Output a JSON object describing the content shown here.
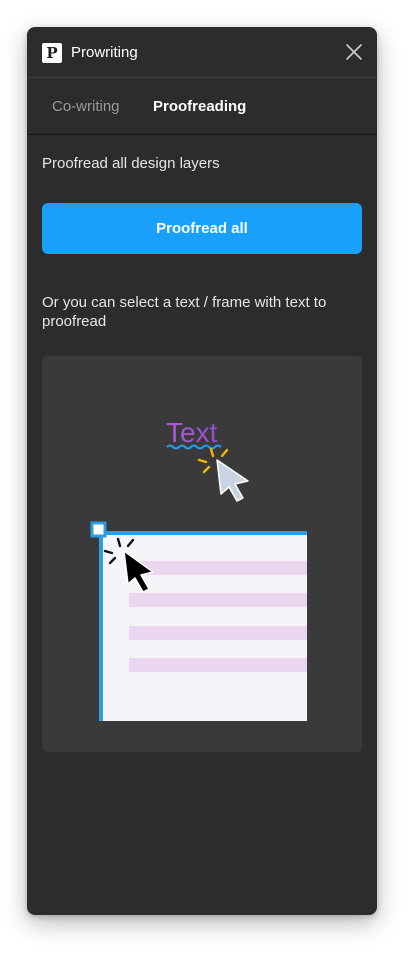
{
  "app": {
    "title": "Prowriting",
    "logo_letter": "P"
  },
  "tabs": [
    {
      "label": "Co-writing",
      "active": false
    },
    {
      "label": "Proofreading",
      "active": true
    }
  ],
  "proofread": {
    "intro": "Proofread all design layers",
    "button_label": "Proofread all",
    "hint": "Or you can select a text / frame with text to proofread"
  },
  "illustration": {
    "sample_text": "Text"
  },
  "colors": {
    "panel_bg": "#2c2c2c",
    "accent": "#18a0fb",
    "illustration_bg": "#3a3a3a",
    "text_gradient_start": "#b05bd6",
    "text_gradient_end": "#8f4fcf",
    "squiggle": "#1aa3ff",
    "sparkle": "#f2b705",
    "frame_border": "#2f9be0",
    "line_fill": "#ead7ef"
  }
}
